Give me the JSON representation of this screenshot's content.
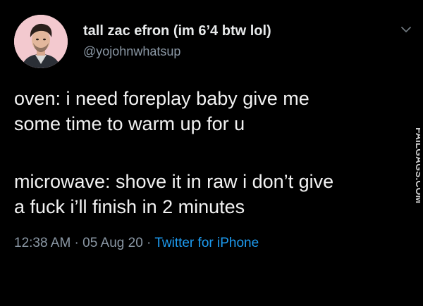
{
  "author": {
    "display_name": "tall zac efron (im 6’4 btw lol)",
    "handle": "@yojohnwhatsup"
  },
  "tweet": {
    "paragraph_1": "oven: i need foreplay baby give me\nsome time to warm up for u",
    "paragraph_2": "microwave: shove it in raw i don’t give\na fuck i’ll finish in 2 minutes"
  },
  "meta": {
    "time": "12:38 AM",
    "separator": " · ",
    "date": "05 Aug 20",
    "source": "Twitter for iPhone"
  },
  "watermark": {
    "text": "FAILGAGS.COM"
  },
  "icons": {
    "menu": "chevron-down-icon"
  },
  "colors": {
    "background": "#000000",
    "text": "#e7e9ea",
    "secondary": "#8b98a5",
    "link": "#1d9bf0",
    "avatar_bg": "#f3c9cf"
  }
}
